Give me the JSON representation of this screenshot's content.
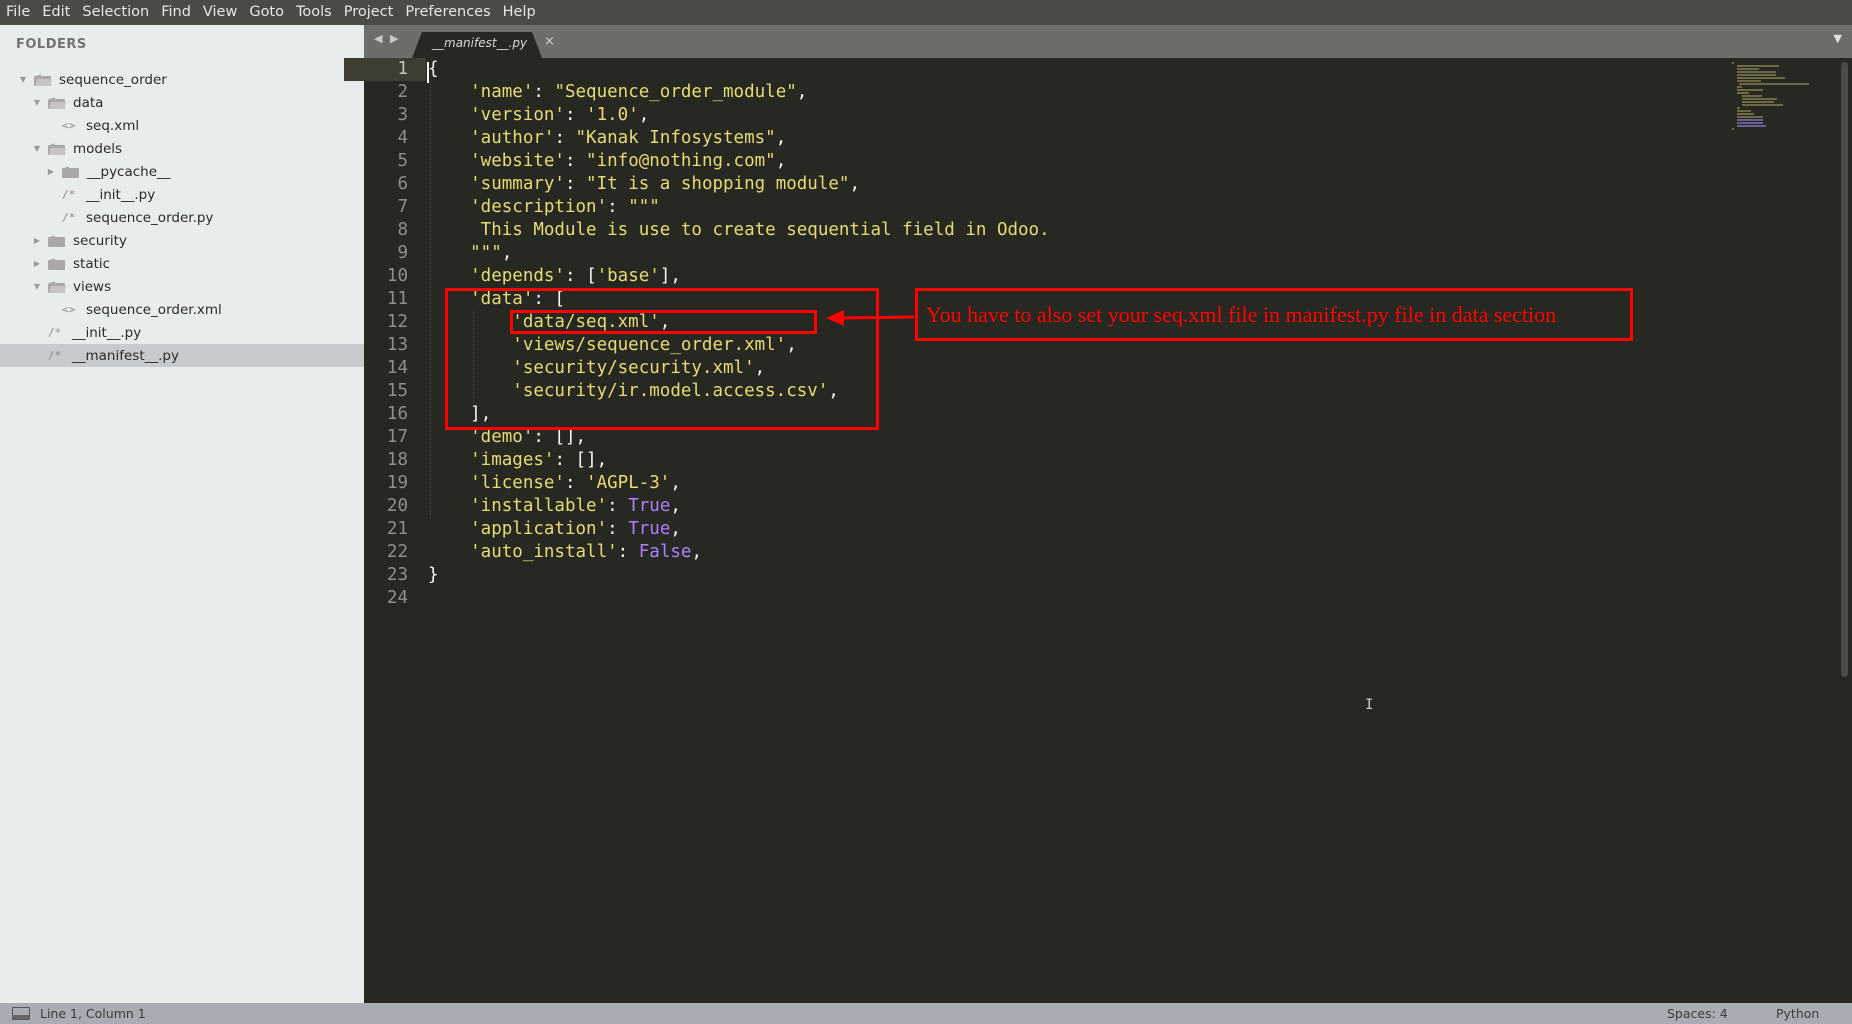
{
  "menu": [
    "File",
    "Edit",
    "Selection",
    "Find",
    "View",
    "Goto",
    "Tools",
    "Project",
    "Preferences",
    "Help"
  ],
  "sidebar": {
    "title": "FOLDERS",
    "tree": [
      {
        "label": "sequence_order",
        "type": "folder",
        "open": true,
        "depth": 0
      },
      {
        "label": "data",
        "type": "folder",
        "open": true,
        "depth": 1
      },
      {
        "label": "seq.xml",
        "type": "xml",
        "depth": 2
      },
      {
        "label": "models",
        "type": "folder",
        "open": true,
        "depth": 1
      },
      {
        "label": "__pycache__",
        "type": "folder",
        "open": false,
        "depth": 2
      },
      {
        "label": "__init__.py",
        "type": "py",
        "depth": 2
      },
      {
        "label": "sequence_order.py",
        "type": "py",
        "depth": 2
      },
      {
        "label": "security",
        "type": "folder",
        "open": false,
        "depth": 1
      },
      {
        "label": "static",
        "type": "folder",
        "open": false,
        "depth": 1
      },
      {
        "label": "views",
        "type": "folder",
        "open": true,
        "depth": 1
      },
      {
        "label": "sequence_order.xml",
        "type": "xml",
        "depth": 2
      },
      {
        "label": "__init__.py",
        "type": "py",
        "depth": 1
      },
      {
        "label": "__manifest__.py",
        "type": "py",
        "depth": 1,
        "selected": true
      }
    ]
  },
  "tab": {
    "label": "__manifest__.py",
    "close": "×",
    "nav": "◀ ▶",
    "dropdown": "▼"
  },
  "editor": {
    "lines": [
      "{",
      "    'name': \"Sequence_order_module\",",
      "    'version': '1.0',",
      "    'author': \"Kanak Infosystems\",",
      "    'website': \"info@nothing.com\",",
      "    'summary': \"It is a shopping module\",",
      "    'description': \"\"\"",
      "     This Module is use to create sequential field in Odoo.",
      "    \"\"\",",
      "    'depends': ['base'],",
      "    'data': [",
      "        'data/seq.xml',",
      "        'views/sequence_order.xml',",
      "        'security/security.xml',",
      "        'security/ir.model.access.csv',",
      "    ],",
      "    'demo': [],",
      "    'images': [],",
      "    'license': 'AGPL-3',",
      "    'installable': True,",
      "    'application': True,",
      "    'auto_install': False,",
      "}",
      ""
    ],
    "active_line": 1
  },
  "annotation": {
    "text": "You have to also set your seq.xml file in manifest.py file in data section",
    "color": "#ff0000"
  },
  "status": {
    "position": "Line 1, Column 1",
    "spaces": "Spaces: 4",
    "syntax": "Python"
  },
  "colors": {
    "background": "#272822",
    "string": "#e6db74",
    "constant": "#ae81ff",
    "punctuation": "#f8f8f2"
  }
}
